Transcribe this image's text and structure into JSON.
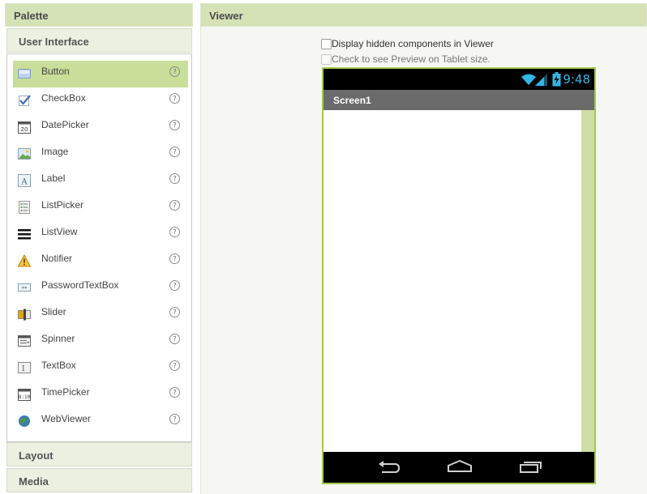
{
  "palette": {
    "title": "Palette",
    "sections": {
      "user_interface": "User Interface",
      "layout": "Layout",
      "media": "Media"
    },
    "help_glyph": "?",
    "items": [
      {
        "label": "Button",
        "icon": "button-icon",
        "selected": true
      },
      {
        "label": "CheckBox",
        "icon": "checkbox-icon"
      },
      {
        "label": "DatePicker",
        "icon": "datepicker-icon"
      },
      {
        "label": "Image",
        "icon": "image-icon"
      },
      {
        "label": "Label",
        "icon": "label-icon"
      },
      {
        "label": "ListPicker",
        "icon": "listpicker-icon"
      },
      {
        "label": "ListView",
        "icon": "listview-icon"
      },
      {
        "label": "Notifier",
        "icon": "notifier-icon"
      },
      {
        "label": "PasswordTextBox",
        "icon": "password-icon"
      },
      {
        "label": "Slider",
        "icon": "slider-icon"
      },
      {
        "label": "Spinner",
        "icon": "spinner-icon"
      },
      {
        "label": "TextBox",
        "icon": "textbox-icon"
      },
      {
        "label": "TimePicker",
        "icon": "timepicker-icon"
      },
      {
        "label": "WebViewer",
        "icon": "webviewer-icon"
      }
    ]
  },
  "viewer": {
    "title": "Viewer",
    "display_hidden_label": "Display hidden components in Viewer",
    "tablet_preview_label": "Check to see Preview on Tablet size.",
    "phone": {
      "time": "9:48",
      "screen_title": "Screen1"
    }
  },
  "colors": {
    "header_bg": "#d5e2b5",
    "selected_bg": "#c9de99",
    "phone_border": "#a6c84a",
    "status_accent": "#33b5e5"
  }
}
